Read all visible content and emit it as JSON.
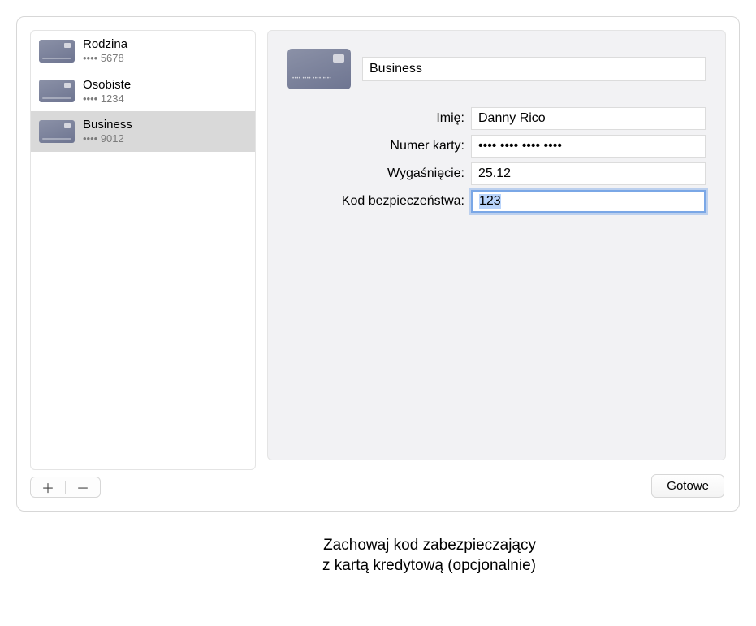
{
  "sidebar": {
    "items": [
      {
        "name": "Rodzina",
        "mask": "•••• 5678"
      },
      {
        "name": "Osobiste",
        "mask": "•••• 1234"
      },
      {
        "name": "Business",
        "mask": "•••• 9012"
      }
    ],
    "selected_index": 2
  },
  "detail": {
    "title": "Business",
    "fields": {
      "name_label": "Imię:",
      "name_value": "Danny Rico",
      "number_label": "Numer karty:",
      "number_value": "•••• •••• •••• ••••",
      "expiry_label": "Wygaśnięcie:",
      "expiry_value": "25.12",
      "security_label": "Kod bezpieczeństwa:",
      "security_value": "123"
    }
  },
  "buttons": {
    "done": "Gotowe"
  },
  "callout": {
    "line1": "Zachowaj kod zabezpieczający",
    "line2": "z kartą kredytową (opcjonalnie)"
  }
}
